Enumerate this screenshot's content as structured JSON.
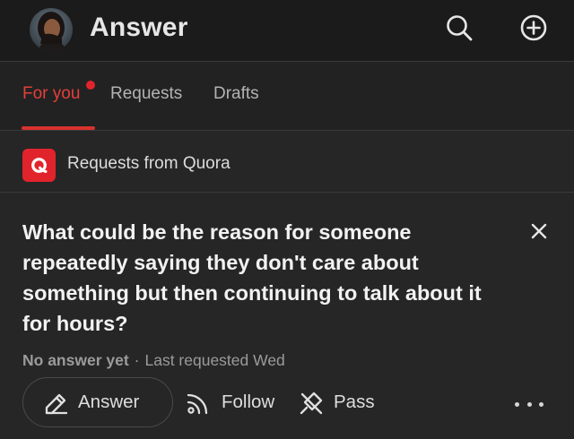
{
  "header": {
    "title": "Answer",
    "icons": [
      "avatar",
      "search-icon",
      "add-circle-icon"
    ]
  },
  "tabs": [
    {
      "label": "For you",
      "active": true,
      "has_notification_dot": true
    },
    {
      "label": "Requests",
      "active": false
    },
    {
      "label": "Drafts",
      "active": false
    }
  ],
  "source": {
    "label": "Requests from Quora",
    "logo_letter": "Q"
  },
  "question": {
    "text": "What could be the reason for someone repeatedly saying they don't care about something but then continuing to talk about it for hours?",
    "status": "No answer yet",
    "separator": "·",
    "last_requested": "Last requested Wed"
  },
  "actions": {
    "answer_label": "Answer",
    "follow_label": "Follow",
    "pass_label": "Pass"
  },
  "colors": {
    "accent": "#e53f39",
    "brand_red": "#e1242b",
    "background": "#262626",
    "header_bg": "#1b1b1b"
  }
}
